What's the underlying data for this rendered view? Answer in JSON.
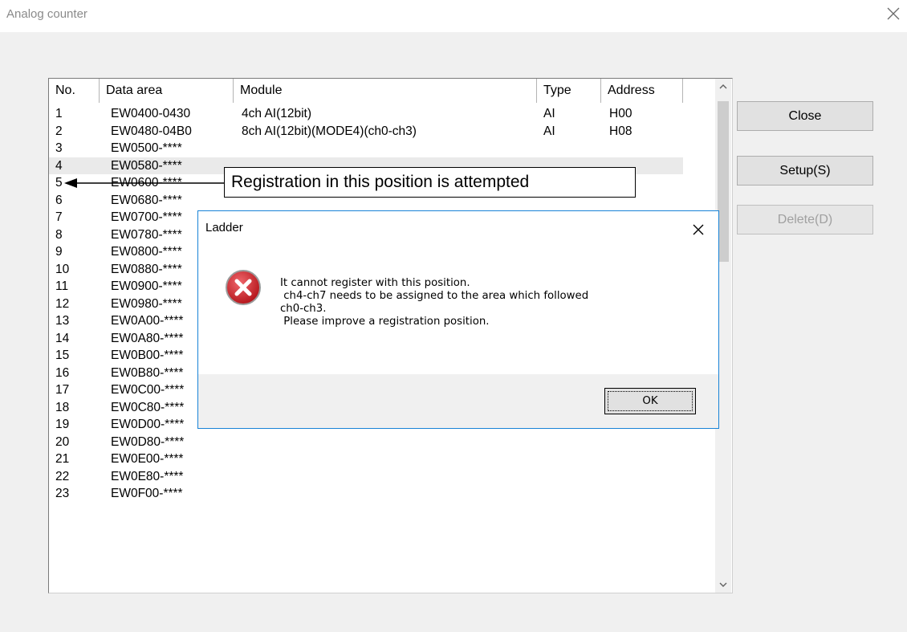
{
  "window": {
    "title": "Analog counter",
    "close_icon": "close-icon"
  },
  "list": {
    "columns": {
      "no": "No.",
      "data_area": "Data area",
      "module": "Module",
      "type": "Type",
      "address": "Address"
    },
    "rows": [
      {
        "no": "1",
        "data_area": "EW0400-0430",
        "module": "4ch AI(12bit)",
        "type": "AI",
        "address": "H00"
      },
      {
        "no": "2",
        "data_area": "EW0480-04B0",
        "module": "8ch AI(12bit)(MODE4)(ch0-ch3)",
        "type": "AI",
        "address": "H08"
      },
      {
        "no": "3",
        "data_area": "EW0500-****"
      },
      {
        "no": "4",
        "data_area": "EW0580-****"
      },
      {
        "no": "5",
        "data_area": "EW0600-****"
      },
      {
        "no": "6",
        "data_area": "EW0680-****"
      },
      {
        "no": "7",
        "data_area": "EW0700-****"
      },
      {
        "no": "8",
        "data_area": "EW0780-****"
      },
      {
        "no": "9",
        "data_area": "EW0800-****"
      },
      {
        "no": "10",
        "data_area": "EW0880-****"
      },
      {
        "no": "11",
        "data_area": "EW0900-****"
      },
      {
        "no": "12",
        "data_area": "EW0980-****"
      },
      {
        "no": "13",
        "data_area": "EW0A00-****"
      },
      {
        "no": "14",
        "data_area": "EW0A80-****"
      },
      {
        "no": "15",
        "data_area": "EW0B00-****"
      },
      {
        "no": "16",
        "data_area": "EW0B80-****"
      },
      {
        "no": "17",
        "data_area": "EW0C00-****"
      },
      {
        "no": "18",
        "data_area": "EW0C80-****"
      },
      {
        "no": "19",
        "data_area": "EW0D00-****"
      },
      {
        "no": "20",
        "data_area": "EW0D80-****"
      },
      {
        "no": "21",
        "data_area": "EW0E00-****"
      },
      {
        "no": "22",
        "data_area": "EW0E80-****"
      },
      {
        "no": "23",
        "data_area": "EW0F00-****"
      }
    ],
    "selected_row": "4"
  },
  "buttons": {
    "close": "Close",
    "setup": "Setup(S)",
    "delete": "Delete(D)"
  },
  "callout": {
    "text": "Registration in this position is attempted"
  },
  "dialog": {
    "title": "Ladder",
    "icon": "error-icon",
    "message_lines": [
      "It cannot register with this position.",
      " ch4-ch7 needs to be assigned to the area which followed",
      "ch0-ch3.",
      " Please improve a registration position."
    ],
    "ok_label": "OK"
  },
  "colors": {
    "dialog_border": "#1883d7",
    "error_red": "#d9282f",
    "selection": "#eaeaea",
    "window_bg": "#f0f0f0"
  }
}
